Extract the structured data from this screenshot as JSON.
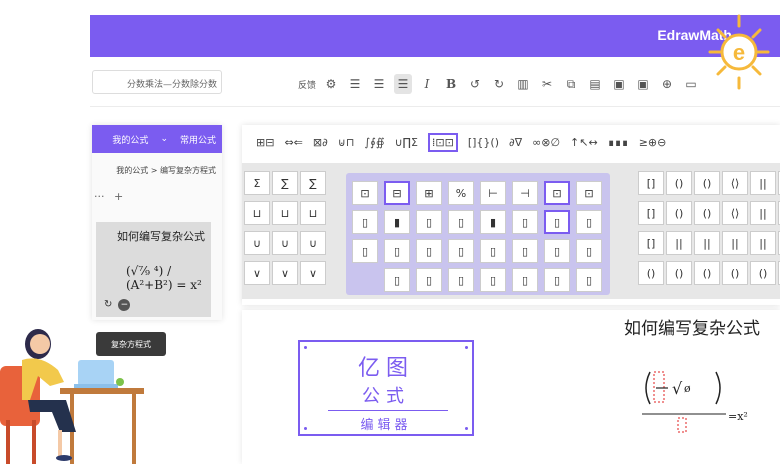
{
  "app": {
    "title": "EdrawMath",
    "logo_text": "e"
  },
  "colors": {
    "brand": "#7b5cf0",
    "toolbar_active": "#e4e4e4",
    "tooltip_bg": "#3a3a3a"
  },
  "toolbar": {
    "search_value": "分数乘法—分数除分数",
    "buttons": [
      {
        "name": "folder-icon",
        "glyph": "▭"
      },
      {
        "name": "add-icon",
        "glyph": "⊕"
      },
      {
        "name": "save-icon",
        "glyph": "▣"
      },
      {
        "name": "save-as-icon",
        "glyph": "▣"
      },
      {
        "name": "print-icon",
        "glyph": "▤"
      },
      {
        "name": "copy-icon",
        "glyph": "⧉"
      },
      {
        "name": "cut-icon",
        "glyph": "✂"
      },
      {
        "name": "paste-icon",
        "glyph": "▥"
      },
      {
        "name": "redo-icon",
        "glyph": "↻"
      },
      {
        "name": "undo-icon",
        "glyph": "↺"
      },
      {
        "name": "bold-icon",
        "glyph": "B"
      },
      {
        "name": "italic-icon",
        "glyph": "I"
      },
      {
        "name": "align-center-icon",
        "glyph": "≡"
      },
      {
        "name": "align-left-icon",
        "glyph": "≡"
      },
      {
        "name": "align-right-icon",
        "glyph": "≡"
      }
    ],
    "feedback_label": "反馈",
    "settings_icon": "gear-icon"
  },
  "left_panel": {
    "tabs": [
      "常用公式",
      "我的公式"
    ],
    "breadcrumb": "我的公式 > 编写复杂方程式",
    "add_label": "+",
    "more_label": "···",
    "preview_title": "如何编写复杂公式",
    "tooltip": "复杂方程式"
  },
  "editor": {
    "symbol_row": [
      "⊞⊟",
      "⇔⇐",
      "⊠∂",
      "⊍⊓",
      "∫∮∯",
      "∪∏Σ",
      "⁞⊡⊡",
      "[]{}()",
      "∂∇",
      "∞⊗∅",
      "↑↖↔",
      "∎∎∎",
      "≥⊕⊖"
    ],
    "selected_group_index": 6,
    "grid_left": [
      [
        "Σ",
        "∑",
        "∑"
      ],
      [
        "⊔",
        "⊔",
        "⊔"
      ],
      [
        "∪",
        "∪",
        "∪"
      ],
      [
        "∨",
        "∨",
        "∨"
      ]
    ],
    "grid_mid": [
      [
        "⊡",
        "⊟",
        "⊞",
        "%",
        "⊢",
        "⊣",
        "⊡",
        "⊡"
      ],
      [
        "▯",
        "▮",
        "▯",
        "▯",
        "▮",
        "▯",
        "▯",
        "▯"
      ],
      [
        "▯",
        "▯",
        "▯",
        "▯",
        "▯",
        "▯",
        "▯",
        "▯"
      ],
      [
        "",
        "▯",
        "▯",
        "▯",
        "▯",
        "▯",
        "▯",
        "▯"
      ]
    ],
    "grid_right": [
      [
        "[]",
        "()",
        "()",
        "⟨⟩",
        "||",
        "||"
      ],
      [
        "[]",
        "()",
        "()",
        "⟨⟩",
        "||",
        "||"
      ],
      [
        "[]",
        "||",
        "||",
        "||",
        "||",
        "||"
      ],
      [
        "()",
        "()",
        "()",
        "()",
        "()",
        "()"
      ]
    ]
  },
  "canvas": {
    "title": "如何编写复杂公式",
    "stamp_line1": "亿图",
    "stamp_amp": "&",
    "stamp_line2": "公式",
    "stamp_line3": "编辑器"
  }
}
